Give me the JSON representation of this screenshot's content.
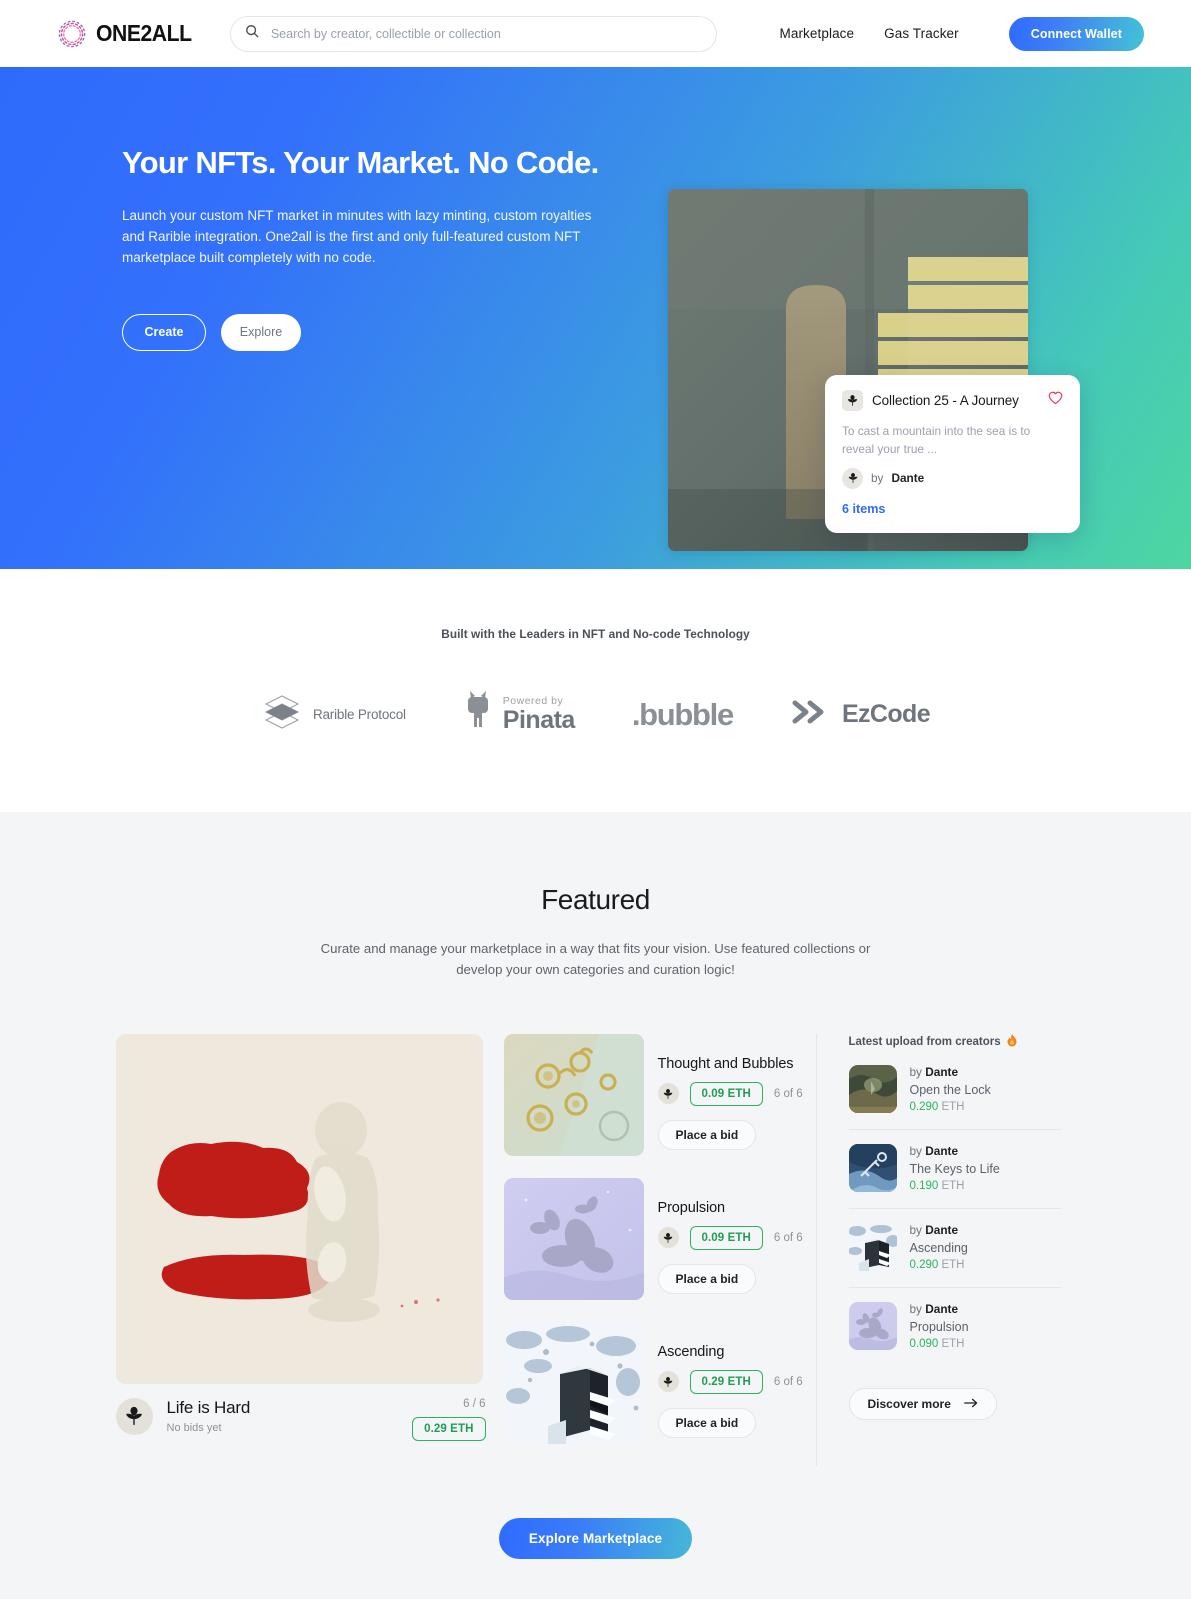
{
  "brand": {
    "name": "ONE2ALL",
    "logo_icon": "one2all-spiral-logo"
  },
  "search": {
    "placeholder": "Search by creator, collectible or collection",
    "value": "",
    "icon": "search-icon"
  },
  "nav": {
    "links": [
      {
        "label": "Marketplace"
      },
      {
        "label": "Gas Tracker"
      }
    ],
    "wallet_button": "Connect Wallet"
  },
  "hero": {
    "title": "Your NFTs. Your Market. No Code.",
    "subtitle": "Launch your custom NFT market in minutes with lazy minting, custom royalties and Rarible integration. One2all is the first and only full-featured custom NFT marketplace built completely with no code.",
    "primary_button": "Create",
    "secondary_button": "Explore",
    "artwork_alt": "abstract grey and yellow painting",
    "collection_card": {
      "title": "Collection 25 - A Journey",
      "description": "To cast a mountain into the sea is to reveal your true ...",
      "by_prefix": "by",
      "creator": "Dante",
      "items": "6 items",
      "like_icon": "heart-icon",
      "avatar_icon": "plant-avatar-icon"
    }
  },
  "partners": {
    "title": "Built with the Leaders in NFT and No-code Technology",
    "items": [
      {
        "name": "Rarible Protocol",
        "icon": "rarible-logo"
      },
      {
        "name": "Pinata",
        "sub": "Powered by",
        "icon": "pinata-logo"
      },
      {
        "name": ".bubble",
        "icon": "bubble-logo"
      },
      {
        "name": "EzCode",
        "icon": "ezcode-logo"
      }
    ]
  },
  "featured": {
    "heading": "Featured",
    "subheading": "Curate and manage your marketplace in a way that fits your vision.  Use featured collections or develop your own categories and curation logic!",
    "main_card": {
      "title": "Life is Hard",
      "bids": "No bids yet",
      "count": "6 / 6",
      "price": "0.29 ETH",
      "artwork_alt": "cream canvas with two red brushstrokes and faint figure"
    },
    "items": [
      {
        "title": "Thought and Bubbles",
        "price": "0.09 ETH",
        "count": "6 of 6",
        "bid_label": "Place a bid",
        "artwork_alt": "yellow ornamental forms on pale green"
      },
      {
        "title": "Propulsion",
        "price": "0.09 ETH",
        "count": "6 of 6",
        "bid_label": "Place a bid",
        "artwork_alt": "grey propellers on lavender"
      },
      {
        "title": "Ascending",
        "price": "0.29 ETH",
        "count": "6 of 6",
        "bid_label": "Place a bid",
        "artwork_alt": "dark staircase in blue snow"
      }
    ],
    "sidebar": {
      "heading": "Latest upload from creators",
      "heading_icon": "flame-icon",
      "by_prefix": "by",
      "items": [
        {
          "creator": "Dante",
          "title": "Open the Lock",
          "price": "0.290",
          "currency": "ETH",
          "artwork_alt": "dark mossy landscape"
        },
        {
          "creator": "Dante",
          "title": "The Keys to Life",
          "price": "0.190",
          "currency": "ETH",
          "artwork_alt": "blue hand with keys"
        },
        {
          "creator": "Dante",
          "title": "Ascending",
          "price": "0.290",
          "currency": "ETH",
          "artwork_alt": "dark staircase in blue snow"
        },
        {
          "creator": "Dante",
          "title": "Propulsion",
          "price": "0.090",
          "currency": "ETH",
          "artwork_alt": "grey propellers on lavender"
        }
      ],
      "discover_label": "Discover more",
      "discover_icon": "arrow-right-icon"
    },
    "explore_button": "Explore Marketplace"
  },
  "colors": {
    "accent_blue": "#2f6bfb",
    "accent_teal": "#45c9b8",
    "price_green": "#2cb35f",
    "heart_pink": "#f4355f"
  }
}
